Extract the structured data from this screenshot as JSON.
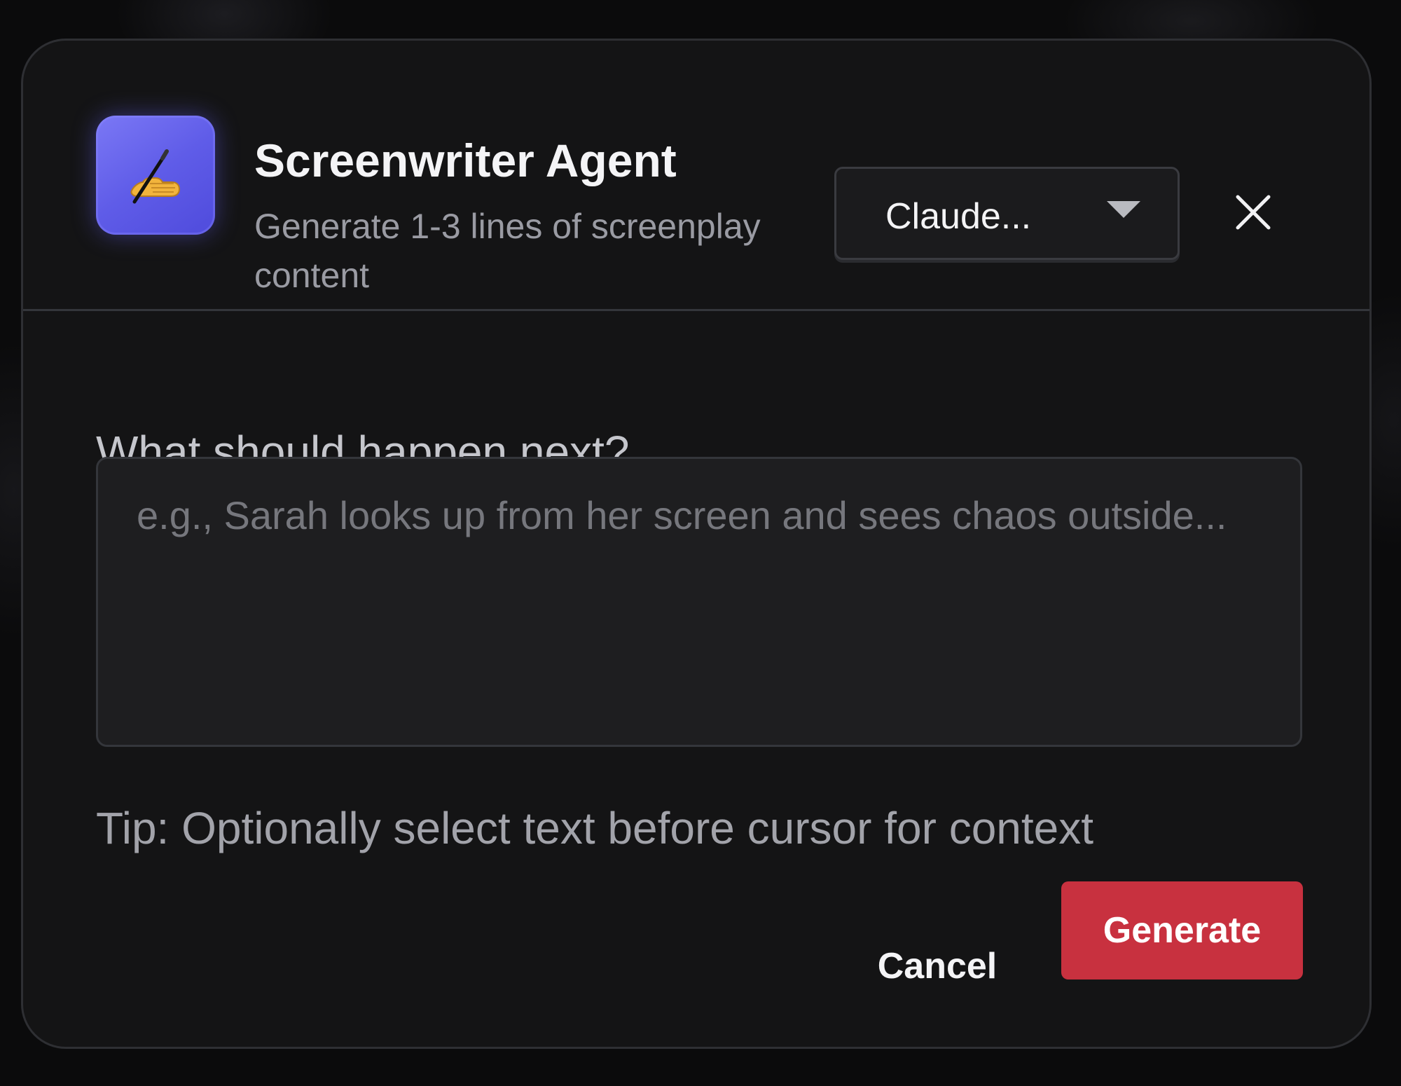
{
  "dialog": {
    "icon": "writing-hand-icon",
    "title": "Screenwriter Agent",
    "subtitle": "Generate 1-3 lines of screenplay content",
    "model_select": {
      "selected": "Claude...",
      "chevron_icon": "chevron-down-icon"
    },
    "close_icon": "close-icon"
  },
  "form": {
    "prompt_label": "What should happen next?",
    "prompt_placeholder": "e.g., Sarah looks up from her screen and sees chaos outside...",
    "prompt_value": "",
    "tip": "Tip: Optionally select text before cursor for context"
  },
  "actions": {
    "cancel_label": "Cancel",
    "generate_label": "Generate"
  },
  "colors": {
    "modal_background": "#141415",
    "accent_icon": "#5f5ce8",
    "primary_button": "#c8313f"
  }
}
